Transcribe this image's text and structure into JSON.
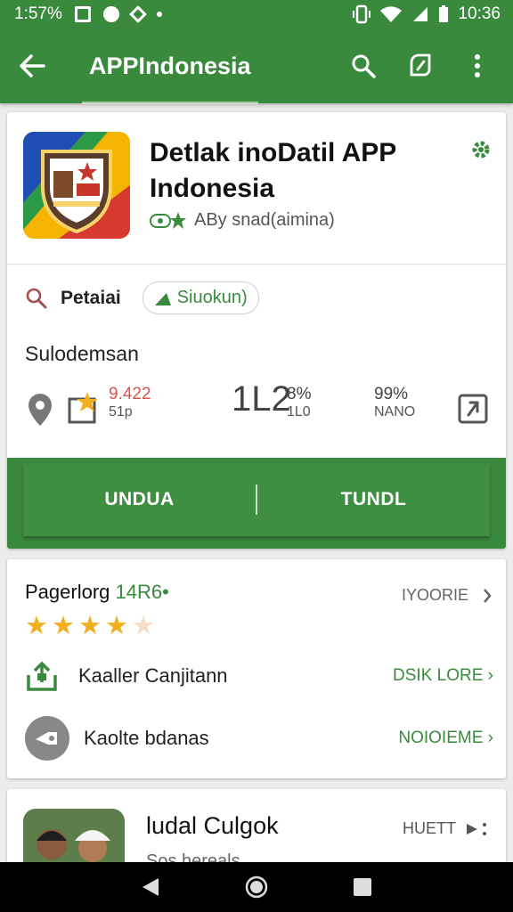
{
  "status_bar": {
    "time_left": "1:57%",
    "time_right": "10:36"
  },
  "app_bar": {
    "title": "APPIndonesia",
    "icons": [
      "back-arrow-icon",
      "search-icon",
      "compose-icon",
      "more-vert-icon"
    ]
  },
  "app_card": {
    "title": "Detlak inoDatil APP Indonesia",
    "developer": "ABy snad(aimina)",
    "category_label": "Petaiai",
    "chip_label": "Siuokun)",
    "section_label": "Sulodemsan",
    "stats": [
      {
        "top": "9.422",
        "bottom": "51p"
      },
      {
        "big": "1L2",
        "top": "8%",
        "bottom": "1L0"
      },
      {
        "top": "99%",
        "bottom": "NANO"
      }
    ],
    "buttons": {
      "left": "UNDUA",
      "right": "TUNDL"
    }
  },
  "rating_card": {
    "title": "Pagerlorg",
    "count": "14R6•",
    "more_label": "IYOORIE",
    "stars": 4,
    "items": [
      {
        "label": "Kaaller Canjitann",
        "link": "DSIK LORE"
      },
      {
        "label": "Kaolte bdanas",
        "link": "NOIOIEME"
      }
    ]
  },
  "bottom_card": {
    "title": "ludal Culgok",
    "subtitle": "Sos hereals",
    "more_label": "HUETT"
  },
  "colors": {
    "primary": "#3a8a3e",
    "star": "#f2b01e"
  }
}
